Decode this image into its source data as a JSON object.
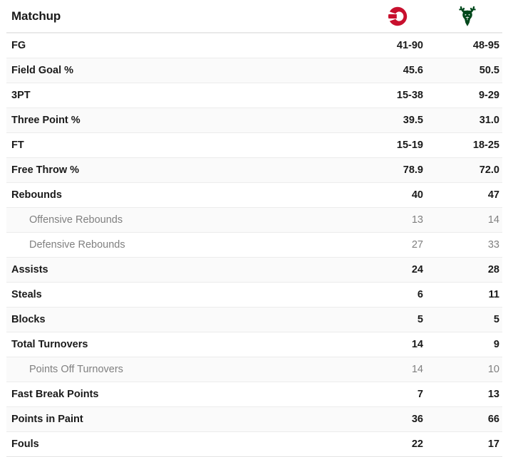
{
  "header": {
    "title": "Matchup",
    "teams": [
      {
        "name": "Atlanta Hawks",
        "abbr": "ATL",
        "logo": "hawks-logo",
        "color": "#C8102E"
      },
      {
        "name": "Milwaukee Bucks",
        "abbr": "MIL",
        "logo": "bucks-logo",
        "color": "#00471B"
      }
    ]
  },
  "rows": [
    {
      "label": "FG",
      "a": "41-90",
      "b": "48-95",
      "sub": false
    },
    {
      "label": "Field Goal %",
      "a": "45.6",
      "b": "50.5",
      "sub": false
    },
    {
      "label": "3PT",
      "a": "15-38",
      "b": "9-29",
      "sub": false
    },
    {
      "label": "Three Point %",
      "a": "39.5",
      "b": "31.0",
      "sub": false
    },
    {
      "label": "FT",
      "a": "15-19",
      "b": "18-25",
      "sub": false
    },
    {
      "label": "Free Throw %",
      "a": "78.9",
      "b": "72.0",
      "sub": false
    },
    {
      "label": "Rebounds",
      "a": "40",
      "b": "47",
      "sub": false
    },
    {
      "label": "Offensive Rebounds",
      "a": "13",
      "b": "14",
      "sub": true
    },
    {
      "label": "Defensive Rebounds",
      "a": "27",
      "b": "33",
      "sub": true
    },
    {
      "label": "Assists",
      "a": "24",
      "b": "28",
      "sub": false
    },
    {
      "label": "Steals",
      "a": "6",
      "b": "11",
      "sub": false
    },
    {
      "label": "Blocks",
      "a": "5",
      "b": "5",
      "sub": false
    },
    {
      "label": "Total Turnovers",
      "a": "14",
      "b": "9",
      "sub": false
    },
    {
      "label": "Points Off Turnovers",
      "a": "14",
      "b": "10",
      "sub": true
    },
    {
      "label": "Fast Break Points",
      "a": "7",
      "b": "13",
      "sub": false
    },
    {
      "label": "Points in Paint",
      "a": "36",
      "b": "66",
      "sub": false
    },
    {
      "label": "Fouls",
      "a": "22",
      "b": "17",
      "sub": false
    }
  ]
}
